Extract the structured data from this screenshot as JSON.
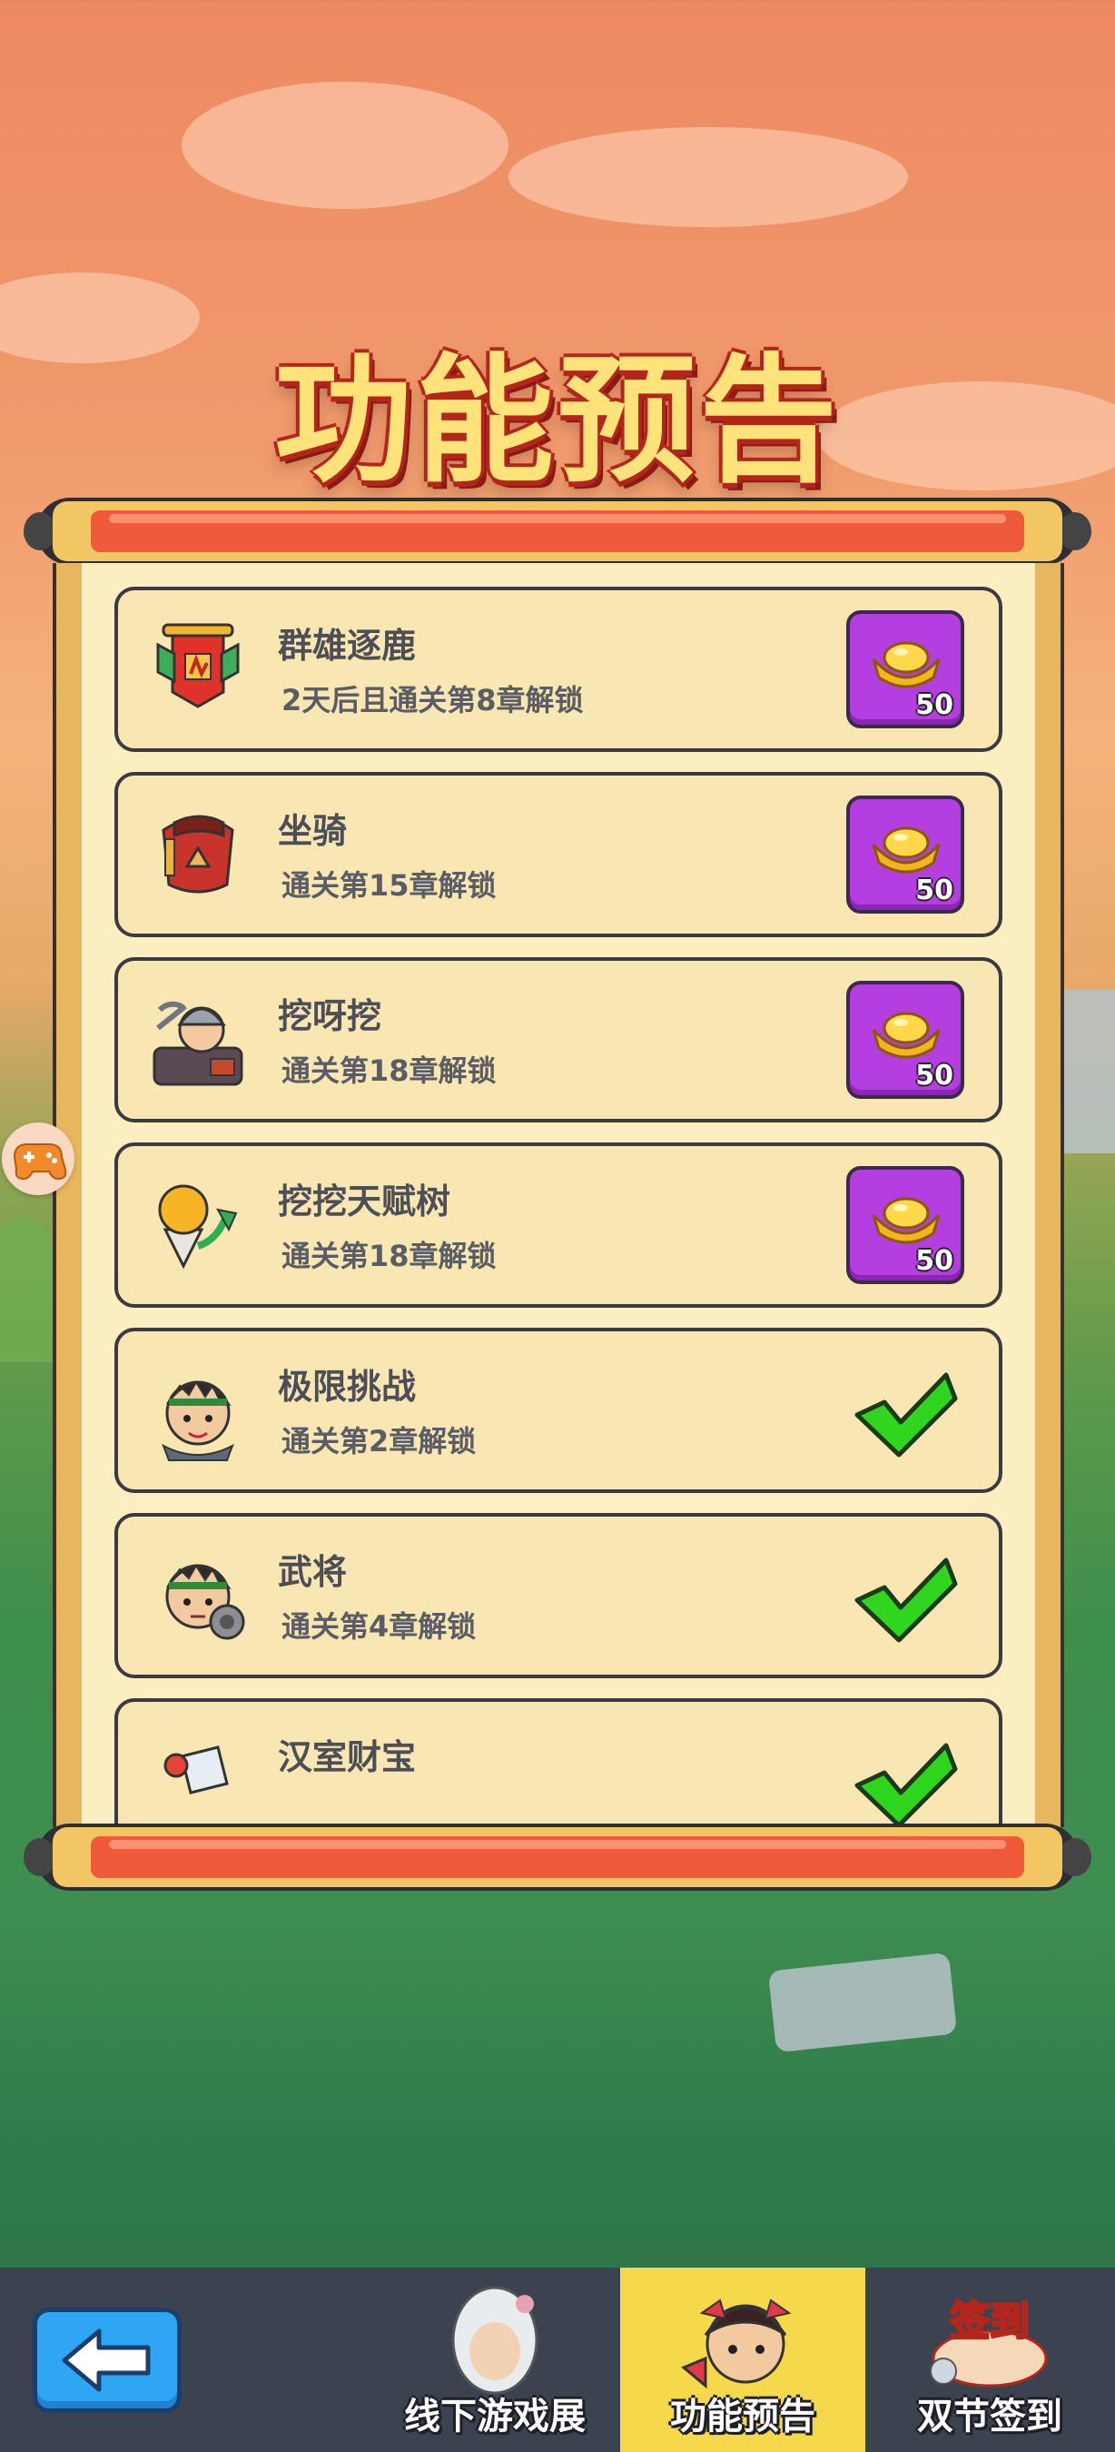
{
  "title": "功能预告",
  "features": [
    {
      "name": "群雄逐鹿",
      "desc": "2天后且通关第8章解锁",
      "status": "reward",
      "reward": "50",
      "icon": "banner-icon"
    },
    {
      "name": "坐骑",
      "desc": "通关第15章解锁",
      "status": "reward",
      "reward": "50",
      "icon": "saddle-icon"
    },
    {
      "name": "挖呀挖",
      "desc": "通关第18章解锁",
      "status": "reward",
      "reward": "50",
      "icon": "miner-icon"
    },
    {
      "name": "挖挖天赋树",
      "desc": "通关第18章解锁",
      "status": "reward",
      "reward": "50",
      "icon": "fist-upgrade-icon"
    },
    {
      "name": "极限挑战",
      "desc": "通关第2章解锁",
      "status": "done",
      "icon": "warrior-icon"
    },
    {
      "name": "武将",
      "desc": "通关第4章解锁",
      "status": "done",
      "icon": "general-icon"
    },
    {
      "name": "汉室财宝",
      "desc": "",
      "status": "done",
      "icon": "treasure-icon"
    }
  ],
  "bottom_nav": {
    "tabs": [
      {
        "label": "线下游戏展",
        "icon": "offline-expo-icon",
        "active": false
      },
      {
        "label": "功能预告",
        "icon": "feature-preview-icon",
        "active": true
      },
      {
        "label": "双节签到",
        "icon": "sign-in-icon",
        "active": false
      }
    ],
    "sign_art_text": "签到"
  },
  "colors": {
    "accent": "#f6d94b",
    "reward_bg": "#b43ee0",
    "check": "#2ed61e",
    "title": "#fde37a"
  }
}
